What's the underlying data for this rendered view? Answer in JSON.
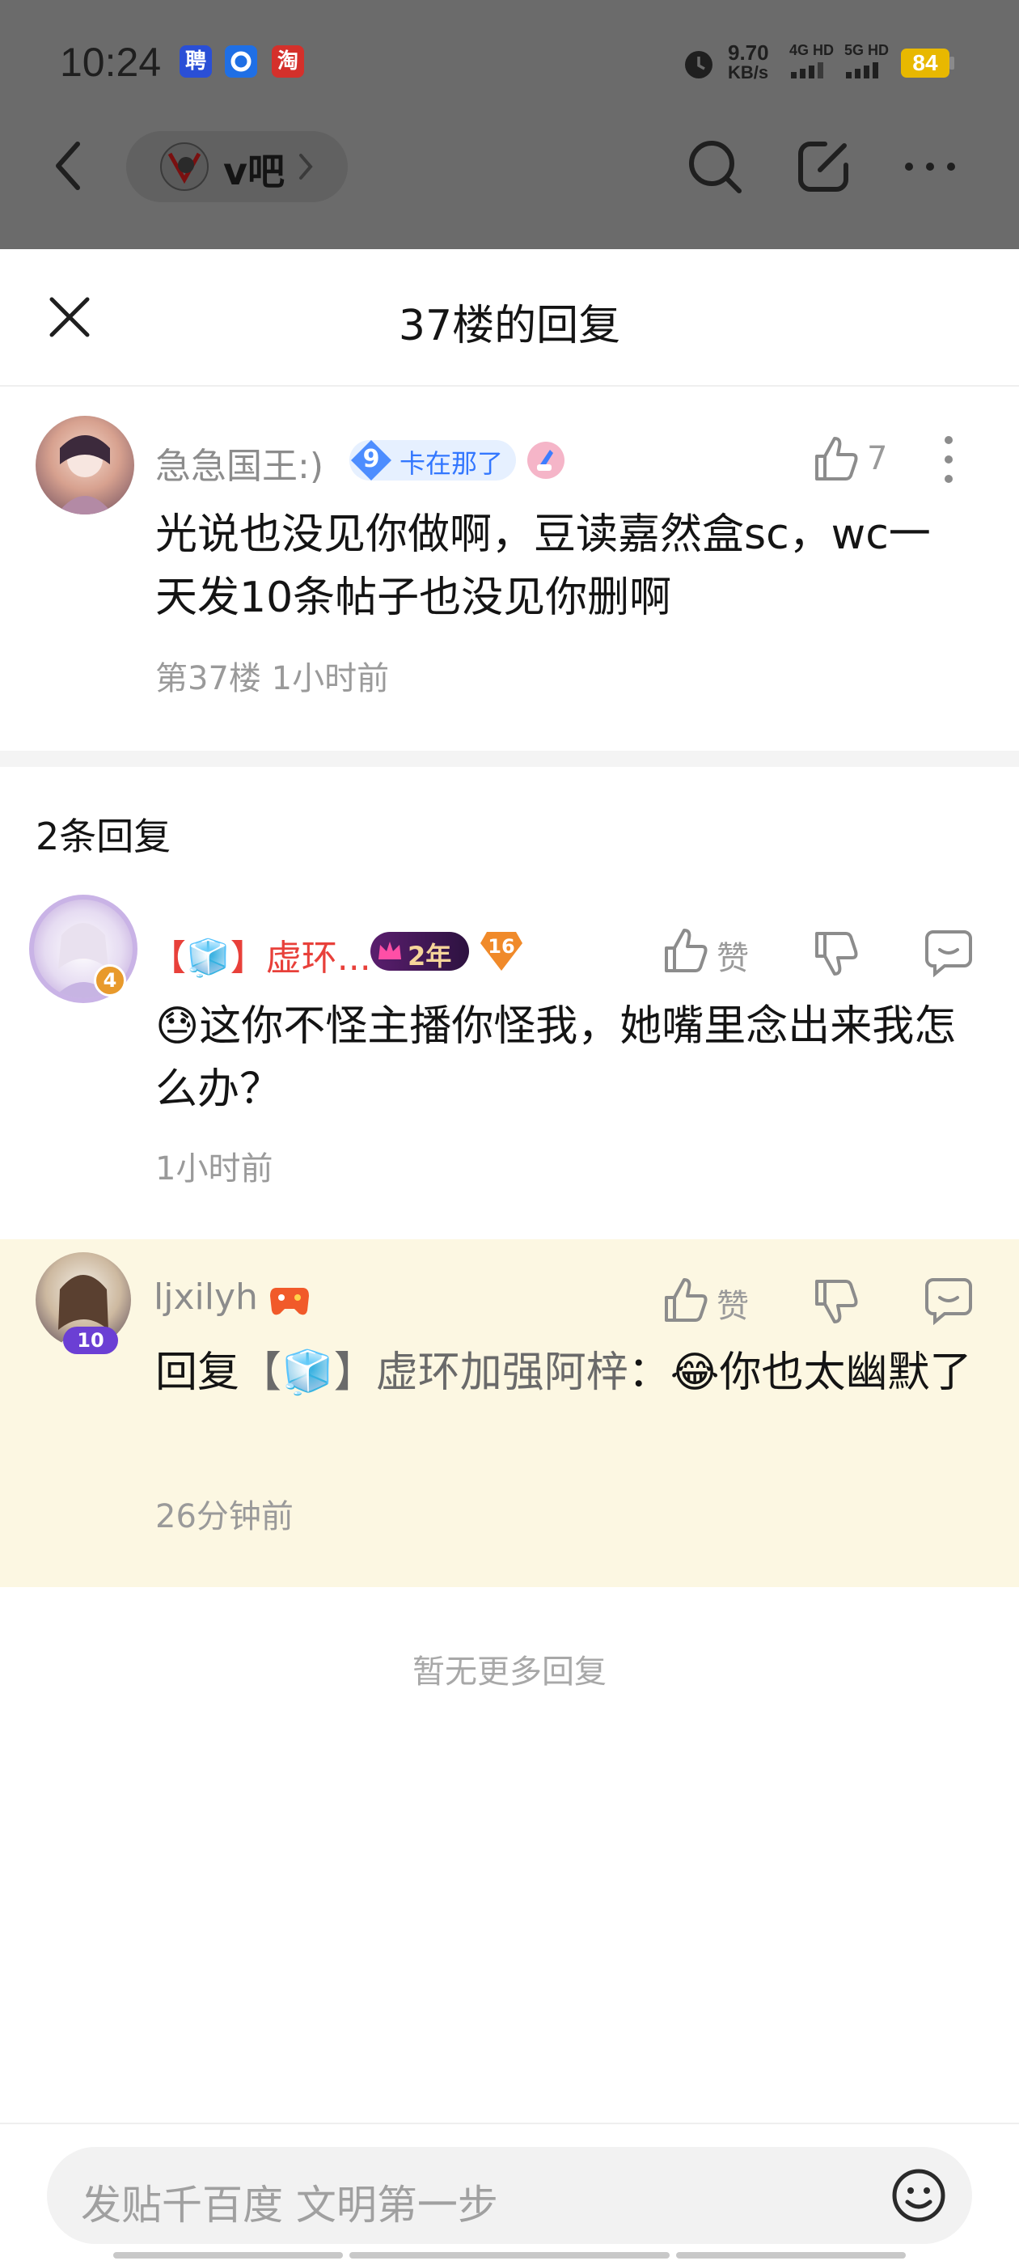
{
  "status_bar": {
    "time": "10:24",
    "app_icons": [
      "聘",
      "",
      "淘"
    ],
    "net_speed_value": "9.70",
    "net_speed_unit": "KB/s",
    "sim1": "4G HD",
    "sim2": "5G HD",
    "battery": "84"
  },
  "nav": {
    "forum_name": "v吧"
  },
  "sheet": {
    "title": "37楼的回复"
  },
  "main_post": {
    "username": "急急国王:)",
    "level": "9",
    "title_badge": "卡在那了",
    "like_count": "7",
    "content": "光说也没见你做啊，豆读嘉然盒sc，wc一天发10条帖子也没见你删啊",
    "floor": "第37楼",
    "time": "1小时前"
  },
  "reply_count": "2条回复",
  "replies": [
    {
      "username": "【🧊】虚环...",
      "avatar_level": "4",
      "years_badge": "2年",
      "level_badge": "16",
      "like_label": "赞",
      "emoji": "😓",
      "content": "这你不怪主播你怪我，她嘴里念出来我怎么办？",
      "time": "1小时前"
    },
    {
      "username": "ljxilyh",
      "avatar_level": "10",
      "like_label": "赞",
      "reply_prefix": "回复",
      "reply_target": "【🧊】虚环加强阿梓",
      "reply_sep": "：",
      "emoji": "😂",
      "content": "你也太幽默了",
      "time": "26分钟前"
    }
  ],
  "footer": {
    "no_more": "暂无更多回复",
    "input_placeholder": "发贴千百度 文明第一步"
  },
  "colors": {
    "accent_red": "#e8403a",
    "level_blue": "#3377ff",
    "highlight_bg": "#fcf7e2"
  }
}
